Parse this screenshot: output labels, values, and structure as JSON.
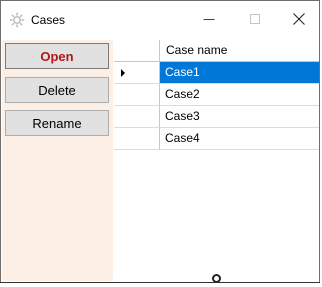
{
  "window": {
    "title": "Cases",
    "icon": "gear-icon"
  },
  "titlebar": {
    "minimize_icon": "minimize-icon",
    "maximize_icon": "maximize-icon",
    "close_icon": "close-icon"
  },
  "commands": {
    "open_label": "Open",
    "delete_label": "Delete",
    "rename_label": "Rename"
  },
  "grid": {
    "column_header": "Case name",
    "rows": [
      {
        "name": "Case1",
        "selected": true
      },
      {
        "name": "Case2",
        "selected": false
      },
      {
        "name": "Case3",
        "selected": false
      },
      {
        "name": "Case4",
        "selected": false
      }
    ]
  },
  "colors": {
    "left_panel_bg": "#fbefe6",
    "selection_bg": "#0078d7",
    "open_text": "#b01818",
    "button_bg": "#e1e1e1"
  }
}
